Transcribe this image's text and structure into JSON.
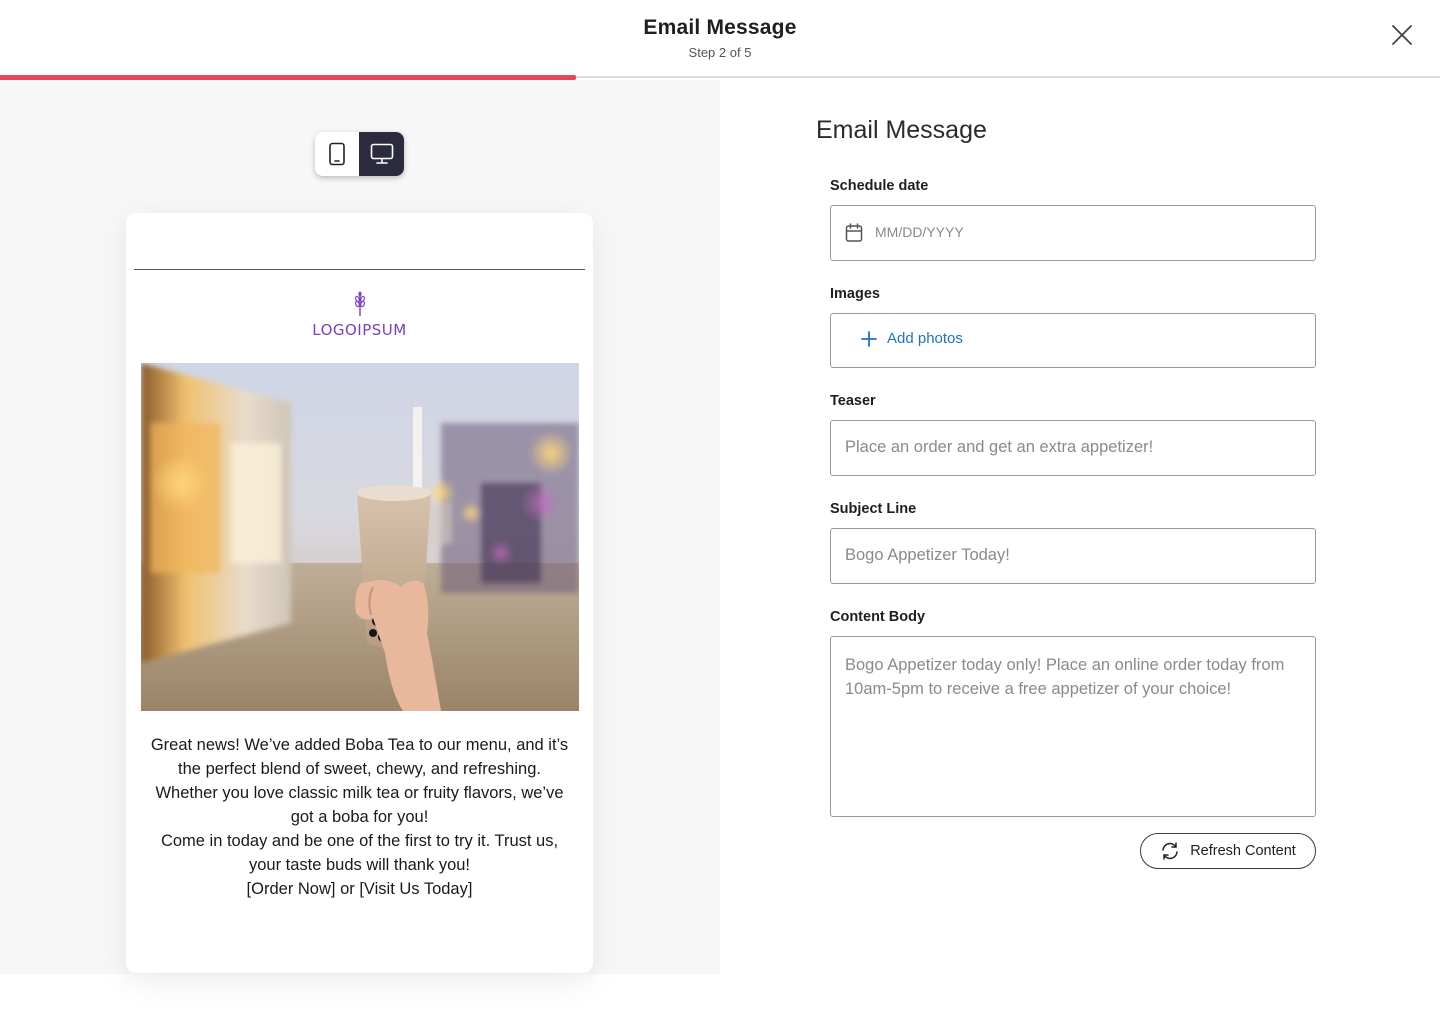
{
  "header": {
    "title": "Email Message",
    "step": "Step 2 of 5",
    "progress": 0.4,
    "accent": "#e8465a"
  },
  "preview": {
    "toggle": {
      "active": "desktop",
      "dark": "#2b2b3d"
    },
    "logo_text": "LOGOIPSUM",
    "logo_color": "#7a3fbf",
    "body_lines": [
      "Great news! We’ve added Boba Tea to our menu, and it’s the perfect blend of sweet, chewy, and refreshing. Whether you love classic milk tea or fruity flavors, we’ve got a boba for you!",
      "Come in today and be one of the first to try it. Trust us, your taste buds will thank you!",
      "[Order Now] or [Visit Us Today]"
    ]
  },
  "form": {
    "title": "Email Message",
    "schedule": {
      "label": "Schedule date",
      "placeholder": "MM/DD/YYYY"
    },
    "images": {
      "label": "Images",
      "add_label": "Add photos"
    },
    "teaser": {
      "label": "Teaser",
      "value": "Place an order and get an extra appetizer!"
    },
    "subject": {
      "label": "Subject Line",
      "value": "Bogo Appetizer Today!"
    },
    "content": {
      "label": "Content Body",
      "value": "Bogo Appetizer today only! Place an online order today from 10am-5pm to receive a free appetizer of your choice!"
    },
    "refresh_label": "Refresh Content",
    "link_color": "#1c74c4"
  }
}
